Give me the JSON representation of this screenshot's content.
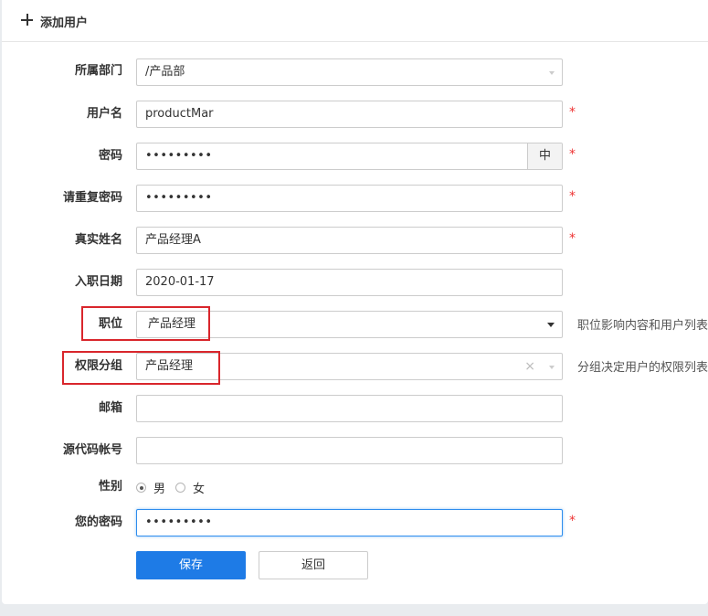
{
  "header": {
    "title": "添加用户",
    "icon": "plus-icon"
  },
  "form": {
    "department": {
      "label": "所属部门",
      "value": "/产品部"
    },
    "username": {
      "label": "用户名",
      "value": "productMar",
      "required": "*"
    },
    "password": {
      "label": "密码",
      "value": "•••••••••",
      "addon": "中",
      "required": "*"
    },
    "password_repeat": {
      "label": "请重复密码",
      "value": "•••••••••",
      "required": "*"
    },
    "real_name": {
      "label": "真实姓名",
      "value": "产品经理A",
      "required": "*"
    },
    "join_date": {
      "label": "入职日期",
      "value": "2020-01-17"
    },
    "position": {
      "label": "职位",
      "value": "产品经理",
      "hint": "职位影响内容和用户列表"
    },
    "group": {
      "label": "权限分组",
      "value": "产品经理",
      "clear": "×",
      "hint": "分组决定用户的权限列表"
    },
    "email": {
      "label": "邮箱",
      "value": ""
    },
    "repo_account": {
      "label": "源代码帐号",
      "value": ""
    },
    "gender": {
      "label": "性别",
      "options": [
        "男",
        "女"
      ],
      "selected": "男"
    },
    "your_password": {
      "label": "您的密码",
      "value": "•••••••••",
      "required": "*"
    }
  },
  "buttons": {
    "save": "保存",
    "back": "返回"
  },
  "colors": {
    "primary": "#1e7be6",
    "required": "#ee3333",
    "highlight_box": "#d9262c",
    "focus_border": "#2e8ded"
  }
}
